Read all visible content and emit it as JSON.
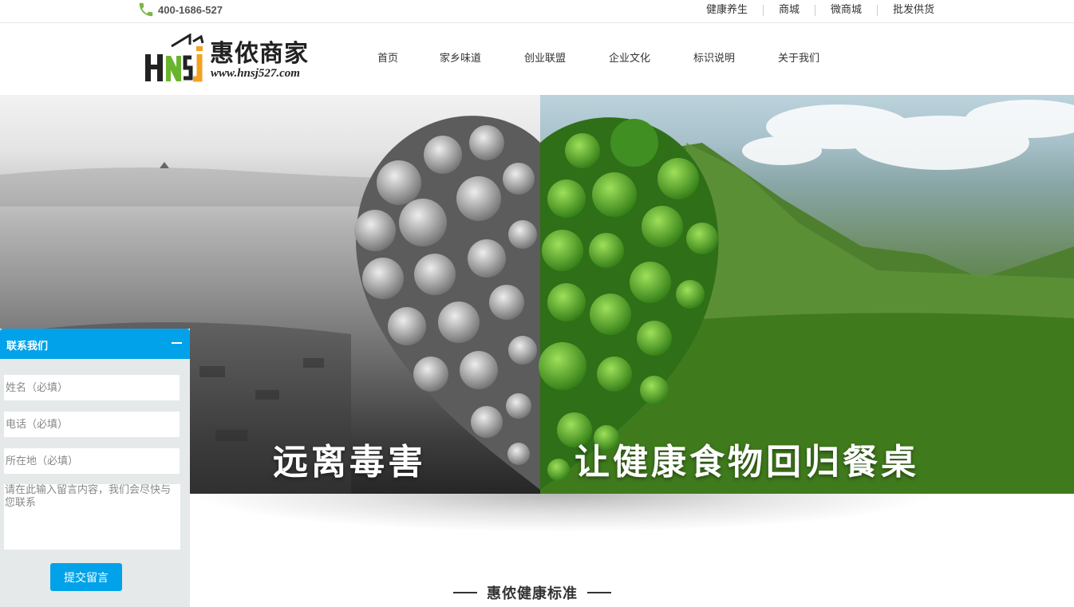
{
  "topbar": {
    "phone_icon": "phone-icon",
    "phone": "400-1686-527",
    "links": [
      "健康养生",
      "商城",
      "微商城",
      "批发供货"
    ]
  },
  "logo": {
    "brand": "惠侬商家",
    "url": "www.hnsj527.com",
    "mark_text": "HNSJ",
    "colors": {
      "green": "#6ab42d",
      "orange": "#f4a21f",
      "dark": "#222222"
    }
  },
  "nav": {
    "items": [
      "首页",
      "家乡味道",
      "创业联盟",
      "企业文化",
      "标识说明",
      "关于我们"
    ]
  },
  "banner": {
    "slogan_left": "远离毒害",
    "slogan_right": "让健康食物回归餐桌"
  },
  "section": {
    "title": "惠侬健康标准"
  },
  "contact": {
    "title": "联系我们",
    "minimize_icon": "minus-icon",
    "name_placeholder": "姓名（必填）",
    "phone_placeholder": "电话（必填）",
    "address_placeholder": "所在地（必填）",
    "message_placeholder": "请在此输入留言内容，我们会尽快与您联系",
    "submit_label": "提交留言",
    "accent_color": "#01a2e9"
  }
}
